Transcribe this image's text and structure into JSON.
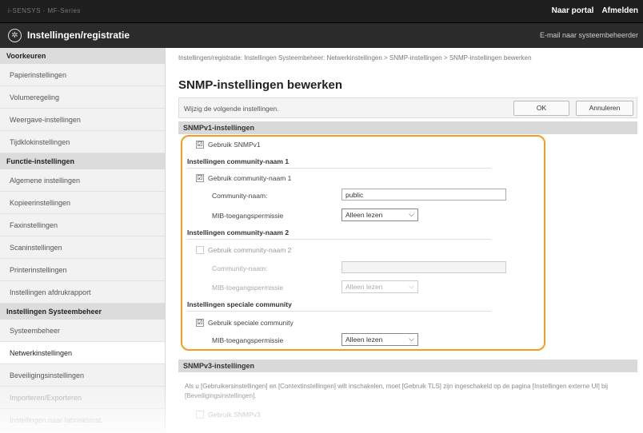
{
  "topbar": {
    "device": "i-SENSYS · MF-Series",
    "links": [
      "Naar portal",
      "Afmelden"
    ]
  },
  "titlebar": {
    "title": "Instellingen/registratie",
    "mail_link": "E-mail naar systeembeheerder"
  },
  "sidebar": {
    "sections": [
      {
        "heading": "Voorkeuren",
        "items": [
          "Papierinstellingen",
          "Volumeregeling",
          "Weergave-instellingen",
          "Tijdklokinstellingen"
        ]
      },
      {
        "heading": "Functie-instellingen",
        "items": [
          "Algemene instellingen",
          "Kopieerinstellingen",
          "Faxinstellingen",
          "Scaninstellingen",
          "Printerinstellingen",
          "Instellingen afdrukrapport"
        ]
      },
      {
        "heading": "Instellingen Systeembeheer",
        "items": [
          "Systeembeheer",
          "Netwerkinstellingen",
          "Beveiligingsinstellingen",
          "Importeren/Exporteren",
          "Instellingen naar fabrieksinst."
        ]
      }
    ],
    "active_item": "Netwerkinstellingen"
  },
  "main": {
    "breadcrumb": "Instellingen/registratie: Instellingen Systeembeheer: Netwerkinstellingen > SNMP-instellingen > SNMP-instellingen bewerken",
    "title": "SNMP-instellingen bewerken",
    "instruction": "Wijzig de volgende instellingen.",
    "ok_label": "OK",
    "cancel_label": "Annuleren",
    "snmpv1": {
      "heading": "SNMPv1-instellingen",
      "use_snmpv1": {
        "label": "Gebruik SNMPv1",
        "checked": "☑"
      },
      "community1": {
        "heading": "Instellingen community-naam 1",
        "use_label": "Gebruik community-naam 1",
        "community_label": "Community-naam:",
        "community_value": "public",
        "mib_label": "MIB-toegangspermissie",
        "mib_value": "Alleen lezen"
      },
      "community2": {
        "heading": "Instellingen community-naam 2",
        "use_label": "Gebruik community-naam 2",
        "community_label": "Community-naam:",
        "community_value": "",
        "mib_label": "MIB-toegangspermissie",
        "mib_value": "Alleen lezen"
      },
      "special": {
        "heading": "Instellingen speciale community",
        "use_label": "Gebruik speciale community",
        "mib_label": "MIB-toegangspermissie",
        "mib_value": "Alleen lezen"
      }
    },
    "snmpv3": {
      "heading": "SNMPv3-instellingen",
      "note": "Als u [Gebruikersinstellingen] en [Contextinstellingen] wilt inschakelen, moet [Gebruik TLS] zijn ingeschakeld op de pagina [Instellingen externe UI] bij [Beveiligingsinstellingen].",
      "use_label": "Gebruik SNMPv3"
    }
  },
  "colors": {
    "highlight": "#f0a020",
    "topbar": "#1e1e1e",
    "section_header": "#d9d9d9"
  }
}
